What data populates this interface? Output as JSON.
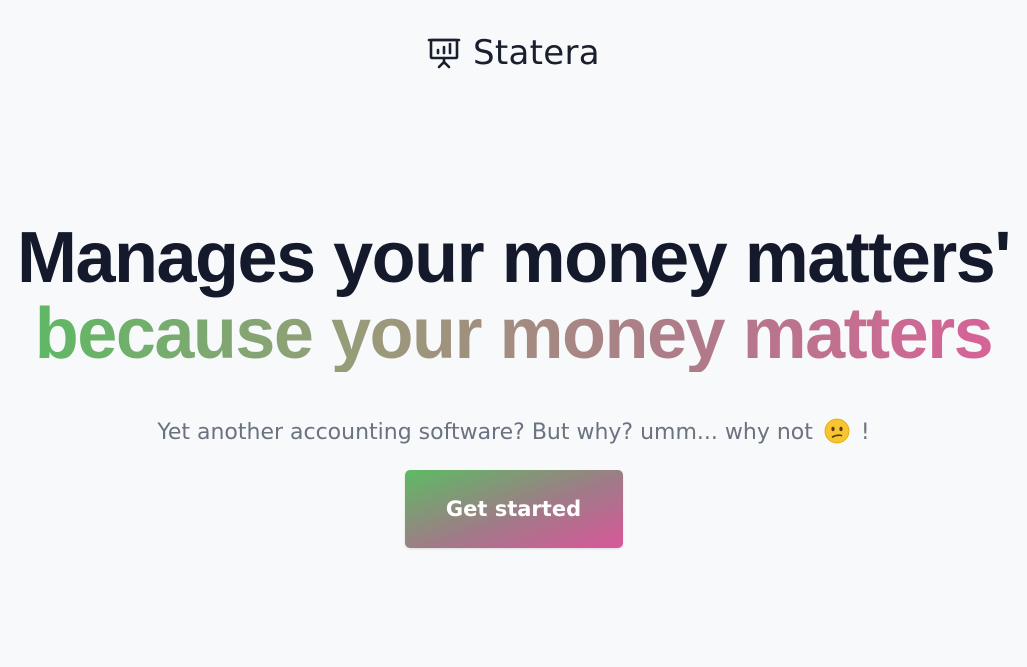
{
  "header": {
    "brand_name": "Statera",
    "brand_icon": "presentation-chart-icon"
  },
  "hero": {
    "headline": "Manages your money matters'",
    "subheadline": "because your money matters",
    "subheadline_gradient": [
      "#5fb865",
      "#d66397"
    ],
    "tagline_before_emoji": "Yet another accounting software? But why? umm... why not",
    "tagline_emoji": "confused-face-icon",
    "tagline_after_emoji": "!"
  },
  "cta": {
    "label": "Get started",
    "gradient": [
      "#5dbb63",
      "#d9579a"
    ]
  }
}
